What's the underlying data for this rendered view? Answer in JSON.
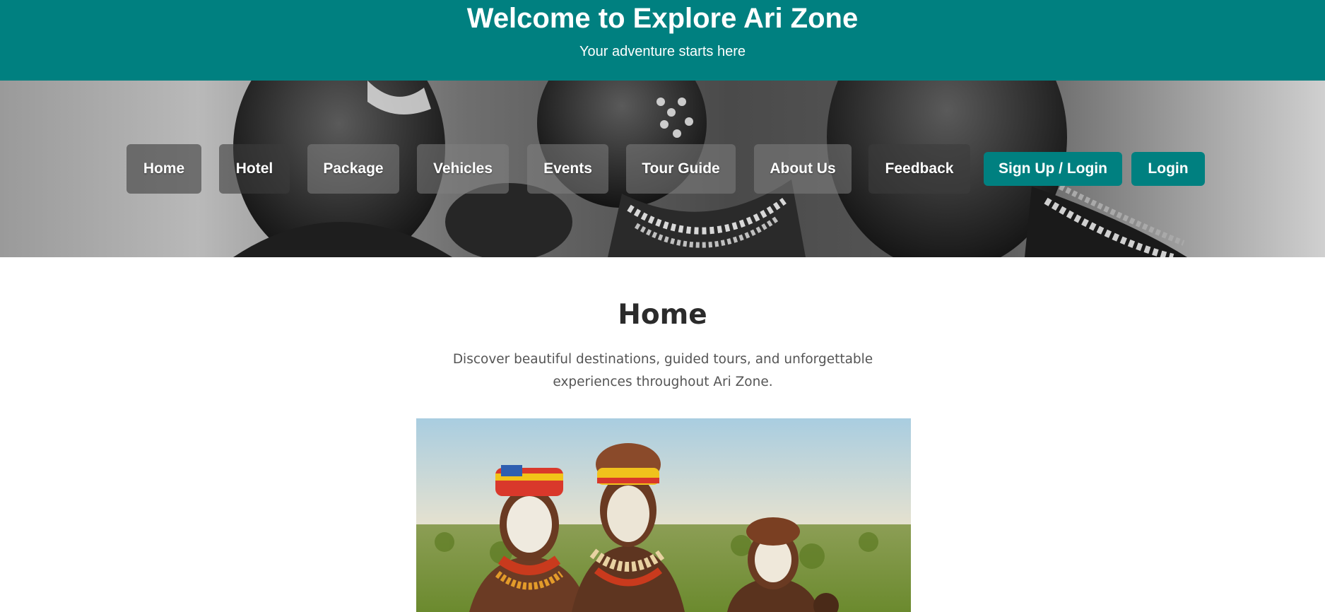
{
  "header": {
    "title": "Welcome to Explore Ari Zone",
    "subtitle": "Your adventure starts here",
    "background_color": "#008080"
  },
  "nav": {
    "items": [
      {
        "label": "Home"
      },
      {
        "label": "Hotel"
      },
      {
        "label": "Package"
      },
      {
        "label": "Vehicles"
      },
      {
        "label": "Events"
      },
      {
        "label": "Tour Guide"
      },
      {
        "label": "About Us"
      },
      {
        "label": "Feedback"
      },
      {
        "label": "Sign Up / Login"
      },
      {
        "label": "Login"
      }
    ],
    "accent_color": "#008080"
  },
  "hero": {
    "image_description": "black-and-white photo of children with beaded necklaces and face paint"
  },
  "main": {
    "heading": "Home",
    "intro": "Discover beautiful destinations, guided tours, and unforgettable experiences throughout Ari Zone.",
    "image_description": "color photo of three people wearing beaded headdresses, necklaces and white face paint in front of green landscape"
  }
}
